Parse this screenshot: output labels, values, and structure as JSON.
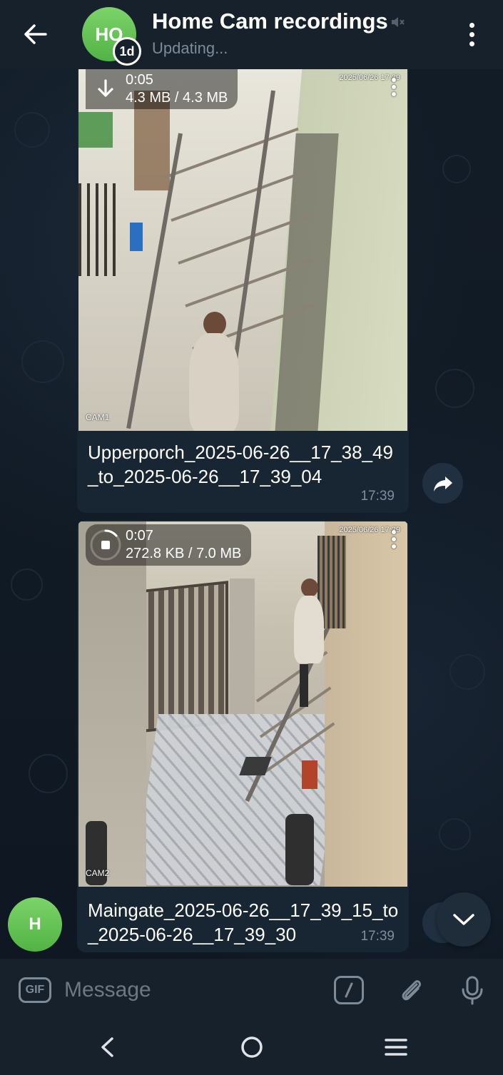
{
  "header": {
    "avatar_initials": "HO",
    "timer_badge": "1d",
    "title": "Home Cam recordings",
    "status": "Updating..."
  },
  "messages": [
    {
      "duration": "0:05",
      "size": "4.3 MB / 4.3 MB",
      "cam_timestamp": "2025/06/26 17:39",
      "cam_label": "CAM1",
      "caption": "Upperporch_2025-06-26__17_38_49_to_2025-06-26__17_39_04",
      "time": "17:39",
      "download_state": "downloaded"
    },
    {
      "duration": "0:07",
      "size": "272.8 KB / 7.0 MB",
      "cam_timestamp": "2025/06/26 17:39",
      "cam_label": "CAM2",
      "caption": "Maingate_2025-06-26__17_39_15_to_2025-06-26__17_39_30",
      "time": "17:39",
      "download_state": "downloading",
      "download_progress": 0.04
    }
  ],
  "sender_avatar_initial": "H",
  "input": {
    "gif_label": "GIF",
    "placeholder": "Message"
  },
  "icons": {
    "back": "arrow-left-icon",
    "mute": "mute-icon",
    "menu": "more-vertical-icon",
    "download": "download-icon",
    "share": "share-icon",
    "scroll_down": "chevron-down-icon",
    "commands": "slash-command-icon",
    "attach": "paperclip-icon",
    "mic": "microphone-icon"
  },
  "colors": {
    "header_bg": "#17212b",
    "chat_bg": "#0e1621",
    "bubble_bg": "#182533",
    "avatar_green": "#5fc350",
    "secondary_text": "#7d8b99"
  }
}
